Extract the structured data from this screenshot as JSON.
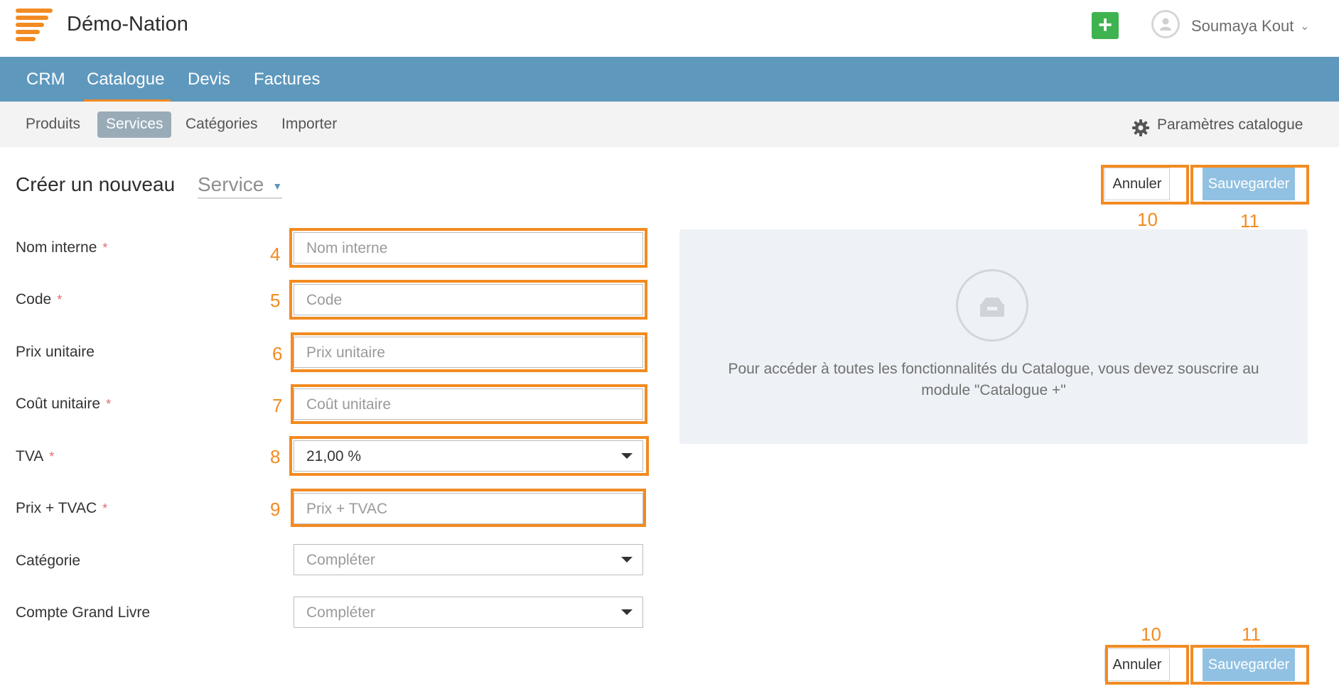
{
  "app": {
    "title": "Démo-Nation"
  },
  "user": {
    "name": "Soumaya Kout"
  },
  "main_nav": {
    "items": [
      "CRM",
      "Catalogue",
      "Devis",
      "Factures"
    ],
    "active": "Catalogue"
  },
  "sub_nav": {
    "items": [
      "Produits",
      "Services",
      "Catégories",
      "Importer"
    ],
    "active": "Services",
    "settings_label": "Paramètres catalogue"
  },
  "form": {
    "title": "Créer un nouveau",
    "type_value": "Service",
    "cancel_label": "Annuler",
    "save_label": "Sauvegarder",
    "fields": [
      {
        "label": "Nom interne",
        "required": true,
        "placeholder": "Nom interne",
        "annotation": "4"
      },
      {
        "label": "Code",
        "required": true,
        "placeholder": "Code",
        "annotation": "5"
      },
      {
        "label": "Prix unitaire",
        "required": false,
        "placeholder": "Prix unitaire",
        "annotation": "6"
      },
      {
        "label": "Coût unitaire",
        "required": true,
        "placeholder": "Coût unitaire",
        "annotation": "7"
      },
      {
        "label": "TVA",
        "required": true,
        "value": "21,00 %",
        "annotation": "8"
      },
      {
        "label": "Prix + TVAC",
        "required": true,
        "placeholder": "Prix + TVAC",
        "annotation": "9"
      },
      {
        "label": "Catégorie",
        "required": false,
        "placeholder": "Compléter"
      },
      {
        "label": "Compte Grand Livre",
        "required": false,
        "placeholder": "Compléter"
      }
    ],
    "required_mark": "*",
    "button_annotations": {
      "cancel": "10",
      "save": "11"
    }
  },
  "info_panel": {
    "text": "Pour accéder à toutes les fonctionnalités du Catalogue, vous devez souscrire au module \"Catalogue +\""
  },
  "colors": {
    "accent": "#f28b22",
    "nav_bg": "#5f98bd",
    "add_button": "#3fb34f",
    "save_button": "#91c1e2",
    "required": "#e06a78"
  },
  "icons": [
    "menu-logo-icon",
    "plus-icon",
    "user-avatar-icon",
    "chevron-down-icon",
    "gear-icon",
    "catalogue-box-icon"
  ]
}
